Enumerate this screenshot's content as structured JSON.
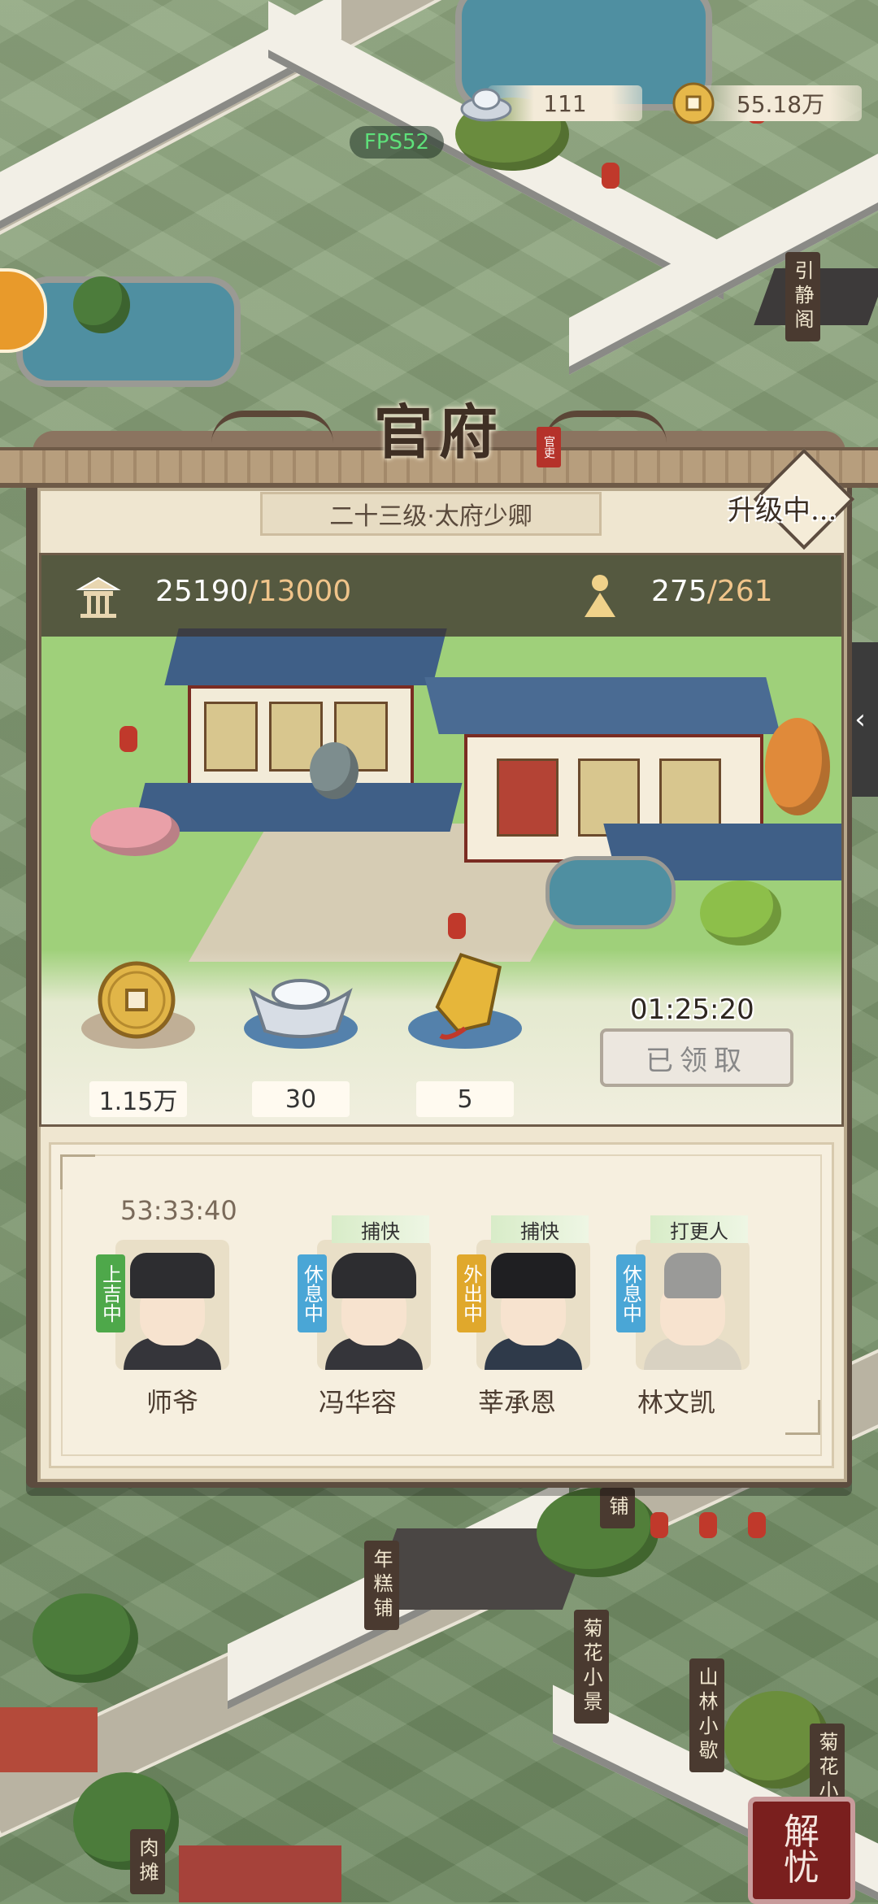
{
  "top_bar": {
    "silver": "111",
    "coins": "55.18万",
    "fps": "FPS52"
  },
  "map_signs": [
    "引静阁",
    "年糕铺",
    "菊花小景",
    "山林小歇",
    "菊花小",
    "肉摊",
    "铺"
  ],
  "panel": {
    "title": "官府",
    "seal_text": "官吏",
    "rank": "二十三级·太府少卿",
    "upgrade_status": "升级中...",
    "prosperity": "25190",
    "prosperity_max": "/13000",
    "population": "275",
    "population_max": "/261",
    "rewards": [
      {
        "icon": "copper-coin-icon",
        "amount": "1.15万"
      },
      {
        "icon": "silver-ingot-icon",
        "amount": "30"
      },
      {
        "icon": "gold-token-icon",
        "amount": "5"
      }
    ],
    "reward_timer": "01:25:20",
    "claim_button": "已领取",
    "close_arrow": "‹"
  },
  "staff": {
    "timer": "53:33:40",
    "members": [
      {
        "name": "师爷",
        "status": "上吉中",
        "role": "",
        "status_color": "#4ea84a"
      },
      {
        "name": "冯华容",
        "status": "休息中",
        "role": "捕快",
        "status_color": "#4aa6d6"
      },
      {
        "name": "莘承恩",
        "status": "外出中",
        "role": "捕快",
        "status_color": "#e0a82c"
      },
      {
        "name": "林文凯",
        "status": "休息中",
        "role": "打更人",
        "status_color": "#4aa6d6"
      }
    ]
  },
  "stamp": {
    "line1": "解",
    "line2": "忧"
  },
  "colors": {
    "panel_frame": "#5c4c3f",
    "panel_paper": "#efe6d0",
    "roof_blue": "#3f5f87",
    "grass": "#9fd07a"
  }
}
